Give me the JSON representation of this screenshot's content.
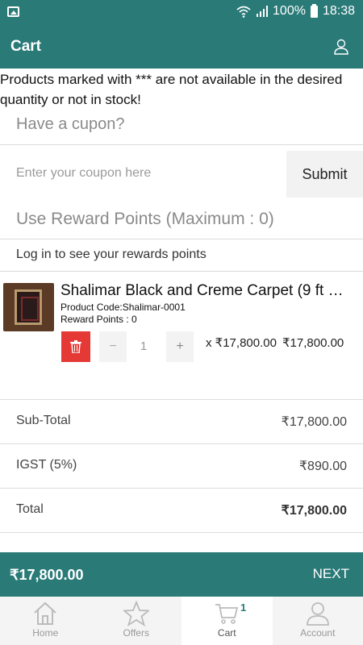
{
  "status_bar": {
    "battery": "100%",
    "time": "18:38"
  },
  "app_bar": {
    "title": "Cart"
  },
  "notice": "Products marked with *** are not available in the desired quantity or not in stock!",
  "coupon": {
    "heading": "Have a cupon?",
    "placeholder": "Enter your coupon here",
    "submit_label": "Submit"
  },
  "reward": {
    "heading": "Use Reward Points (Maximum : 0)",
    "login_text": "Log in to see your rewards points"
  },
  "product": {
    "name": "Shalimar Black and Creme Carpet (9 ft …",
    "code": "Product Code:Shalimar-0001",
    "reward_points": "Reward Points : 0",
    "minus": "−",
    "quantity": "1",
    "plus": "+",
    "unit_price": "x ₹17,800.00",
    "line_total": "₹17,800.00"
  },
  "summary": [
    {
      "label": "Sub-Total",
      "value": "₹17,800.00"
    },
    {
      "label": "IGST (5%)",
      "value": "₹890.00"
    },
    {
      "label": "Total",
      "value": "₹17,800.00"
    }
  ],
  "total_bar": {
    "amount": "₹17,800.00",
    "next_label": "NEXT"
  },
  "bottom_nav": {
    "items": [
      {
        "label": "Home",
        "icon": "home-icon"
      },
      {
        "label": "Offers",
        "icon": "star-icon"
      },
      {
        "label": "Cart",
        "icon": "cart-icon",
        "badge": "1",
        "active": true
      },
      {
        "label": "Account",
        "icon": "user-icon"
      }
    ]
  },
  "colors": {
    "primary": "#2a7a78",
    "delete": "#e53935"
  }
}
